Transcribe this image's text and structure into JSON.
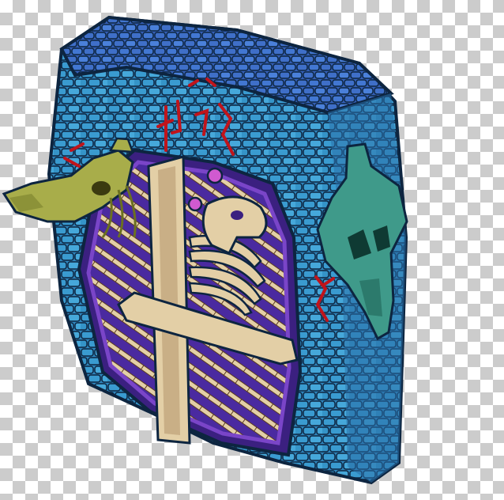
{
  "canvas": {
    "background": "transparency-checkerboard",
    "checker_colors": [
      "#ffffff",
      "#cccccc"
    ]
  },
  "sprite": {
    "subject": "stone-doorway-with-bone-panel",
    "parts": [
      "stone-frame",
      "bone-panel",
      "left-skull-ornament",
      "right-skull-ornament",
      "blood-runes"
    ],
    "colors": {
      "stone_light": "#3a9bd0",
      "stone_dark": "#1f5f8f",
      "stone_top": "#3f6fc8",
      "outline": "#0d2540",
      "bone": "#e3cfa6",
      "bone_shadow": "#b89a72",
      "purple": "#7a45c8",
      "purple_dark": "#3b2080",
      "left_skull": "#a8ad4a",
      "right_skull": "#3f9a8a",
      "blood": "#c0141b"
    }
  }
}
